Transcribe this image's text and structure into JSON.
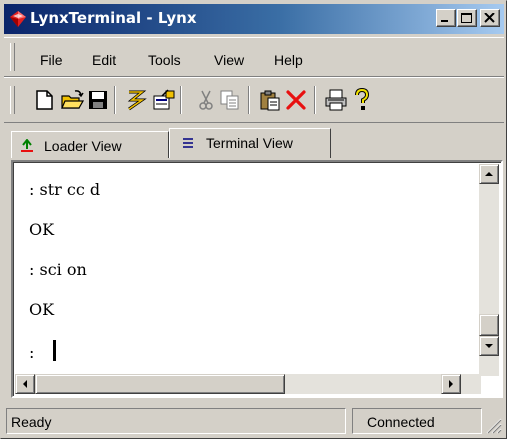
{
  "window": {
    "title": "LynxTerminal - Lynx",
    "controls": {
      "minimize": "minimize-icon",
      "maximize": "maximize-icon",
      "close": "close-icon"
    }
  },
  "menu": {
    "items": [
      "File",
      "Edit",
      "Tools",
      "View",
      "Help"
    ]
  },
  "toolbar": {
    "buttons": [
      "new-icon",
      "open-icon",
      "save-icon",
      "connect-icon",
      "settings-icon",
      "cut-icon",
      "copy-icon",
      "paste-icon",
      "delete-icon",
      "print-icon",
      "help-icon"
    ]
  },
  "tabs": [
    {
      "label": "Loader View",
      "icon": "loader-icon",
      "active": false
    },
    {
      "label": "Terminal View",
      "icon": "terminal-icon",
      "active": true
    }
  ],
  "terminal": {
    "lines": [
      ": str cc d",
      "OK",
      ": sci on",
      "OK",
      ": "
    ]
  },
  "status": {
    "message": "Ready",
    "connection": "Connected"
  },
  "colors": {
    "title_start": "#0a246a",
    "title_end": "#a6caf0",
    "face": "#d4d0c8",
    "delete": "#e81010"
  }
}
